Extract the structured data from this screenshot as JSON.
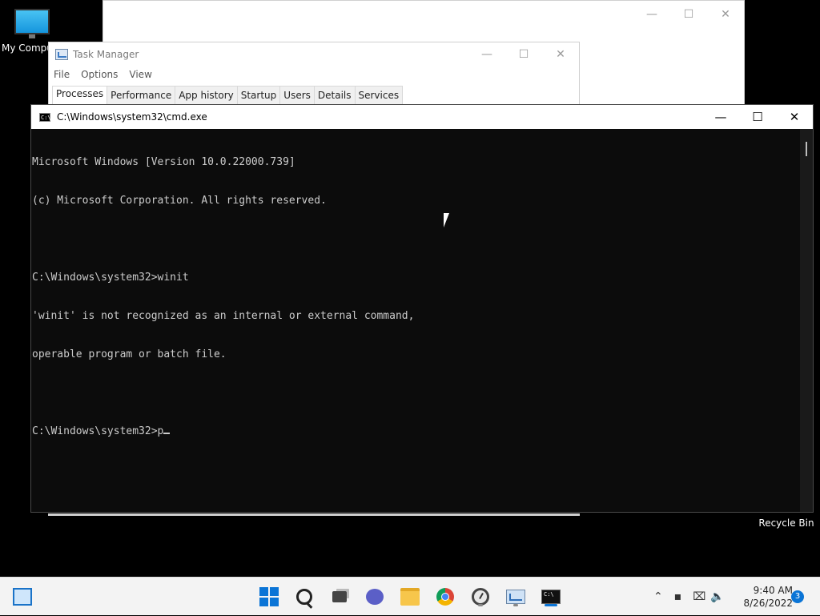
{
  "desktop": {
    "my_computer_label": "My Computer",
    "recycle_bin_label": "Recycle Bin"
  },
  "back_window": {
    "minimize_glyph": "—",
    "maximize_glyph": "☐",
    "close_glyph": "✕"
  },
  "task_manager": {
    "title": "Task Manager",
    "menu": [
      "File",
      "Options",
      "View"
    ],
    "tabs": [
      "Processes",
      "Performance",
      "App history",
      "Startup",
      "Users",
      "Details",
      "Services"
    ],
    "active_tab": "Processes"
  },
  "cmd": {
    "title": "C:\\Windows\\system32\\cmd.exe",
    "icon_text": "C:\\",
    "lines": [
      "Microsoft Windows [Version 10.0.22000.739]",
      "(c) Microsoft Corporation. All rights reserved.",
      "",
      "C:\\Windows\\system32>winit",
      "'winit' is not recognized as an internal or external command,",
      "operable program or batch file.",
      "",
      "C:\\Windows\\system32>p"
    ]
  },
  "taskbar": {
    "icons": [
      "widgets-icon",
      "start-icon",
      "search-icon",
      "task-view-icon",
      "chat-icon",
      "file-explorer-icon",
      "chrome-icon",
      "clock-app-icon",
      "task-manager-icon",
      "cmd-icon"
    ],
    "time": "9:40 AM",
    "date": "8/26/2022",
    "notification_count": "3"
  },
  "colors": {
    "console_bg": "#0c0c0c",
    "console_text": "#cccccc",
    "accent": "#0a74d6"
  }
}
